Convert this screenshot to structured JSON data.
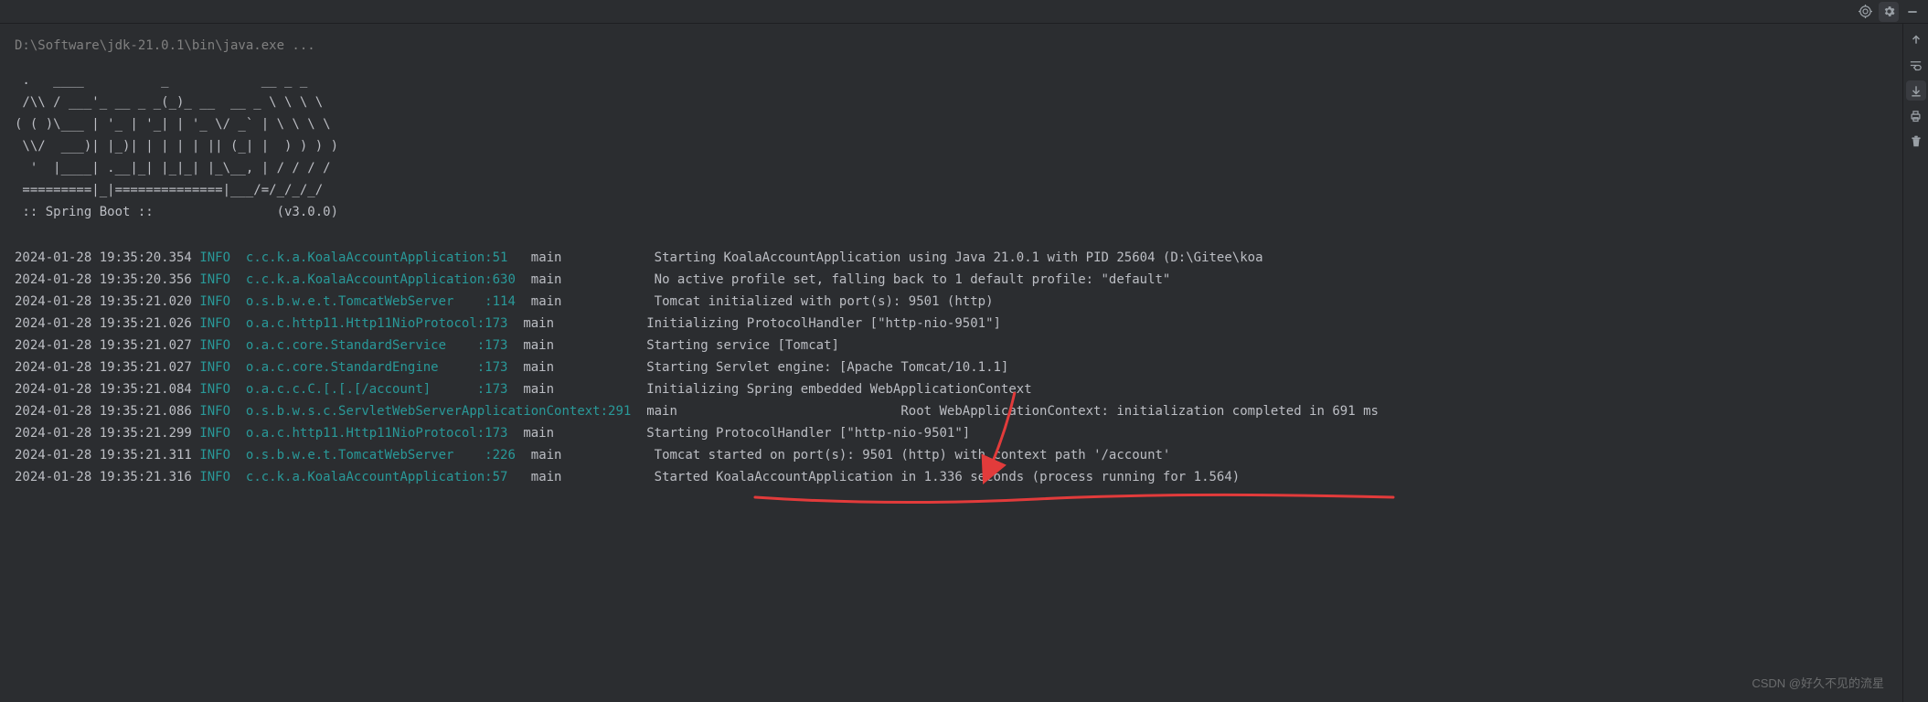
{
  "toolbar_top": {
    "target_icon": "target-icon",
    "gear_icon": "gear-icon",
    "minimize_icon": "minimize-icon"
  },
  "toolbar_right": {
    "scroll_up_icon": "scroll-up-icon",
    "softwrap_icon": "softwrap-icon",
    "scroll_to_end_icon": "scroll-to-end-icon",
    "print_icon": "print-icon",
    "clear_icon": "clear-icon"
  },
  "cmd": "D:\\Software\\jdk-21.0.1\\bin\\java.exe ...",
  "ascii": " .   ____          _            __ _ _\n /\\\\ / ___'_ __ _ _(_)_ __  __ _ \\ \\ \\ \\\n( ( )\\___ | '_ | '_| | '_ \\/ _` | \\ \\ \\ \\\n \\\\/  ___)| |_)| | | | | || (_| |  ) ) ) )\n  '  |____| .__|_| |_|_| |_\\__, | / / / /\n =========|_|==============|___/=/_/_/_/\n :: Spring Boot ::                (v3.0.0)",
  "log": [
    {
      "ts": "2024-01-28 19:35:20.354",
      "lvl": "INFO",
      "src": "c.c.k.a.KoalaAccountApplication:51",
      "pad": "   ",
      "th": "main",
      "mpad": "            ",
      "msg": "Starting KoalaAccountApplication using Java 21.0.1 with PID 25604 (D:\\Gitee\\koa"
    },
    {
      "ts": "2024-01-28 19:35:20.356",
      "lvl": "INFO",
      "src": "c.c.k.a.KoalaAccountApplication:630",
      "pad": "  ",
      "th": "main",
      "mpad": "            ",
      "msg": "No active profile set, falling back to 1 default profile: \"default\""
    },
    {
      "ts": "2024-01-28 19:35:21.020",
      "lvl": "INFO",
      "src": "o.s.b.w.e.t.TomcatWebServer    :114",
      "pad": "  ",
      "th": "main",
      "mpad": "            ",
      "msg": "Tomcat initialized with port(s): 9501 (http)"
    },
    {
      "ts": "2024-01-28 19:35:21.026",
      "lvl": "INFO",
      "src": "o.a.c.http11.Http11NioProtocol:173",
      "pad": "  ",
      "th": "main",
      "mpad": "            ",
      "msg": "Initializing ProtocolHandler [\"http-nio-9501\"]"
    },
    {
      "ts": "2024-01-28 19:35:21.027",
      "lvl": "INFO",
      "src": "o.a.c.core.StandardService    :173",
      "pad": "  ",
      "th": "main",
      "mpad": "            ",
      "msg": "Starting service [Tomcat]"
    },
    {
      "ts": "2024-01-28 19:35:21.027",
      "lvl": "INFO",
      "src": "o.a.c.core.StandardEngine     :173",
      "pad": "  ",
      "th": "main",
      "mpad": "            ",
      "msg": "Starting Servlet engine: [Apache Tomcat/10.1.1]"
    },
    {
      "ts": "2024-01-28 19:35:21.084",
      "lvl": "INFO",
      "src": "o.a.c.c.C.[.[.[/account]      :173",
      "pad": "  ",
      "th": "main",
      "mpad": "            ",
      "msg": "Initializing Spring embedded WebApplicationContext"
    },
    {
      "ts": "2024-01-28 19:35:21.086",
      "lvl": "INFO",
      "src": "o.s.b.w.s.c.ServletWebServerApplicationContext:291",
      "pad": "  ",
      "th": "main",
      "mpad": "                             ",
      "msg": "Root WebApplicationContext: initialization completed in 691 ms"
    },
    {
      "ts": "2024-01-28 19:35:21.299",
      "lvl": "INFO",
      "src": "o.a.c.http11.Http11NioProtocol:173",
      "pad": "  ",
      "th": "main",
      "mpad": "            ",
      "msg": "Starting ProtocolHandler [\"http-nio-9501\"]"
    },
    {
      "ts": "2024-01-28 19:35:21.311",
      "lvl": "INFO",
      "src": "o.s.b.w.e.t.TomcatWebServer    :226",
      "pad": "  ",
      "th": "main",
      "mpad": "            ",
      "msg": "Tomcat started on port(s): 9501 (http) with context path '/account'"
    },
    {
      "ts": "2024-01-28 19:35:21.316",
      "lvl": "INFO",
      "src": "c.c.k.a.KoalaAccountApplication:57",
      "pad": "   ",
      "th": "main",
      "mpad": "            ",
      "msg": "Started KoalaAccountApplication in 1.336 seconds (process running for 1.564)"
    }
  ],
  "watermark": "CSDN @好久不见的流星"
}
